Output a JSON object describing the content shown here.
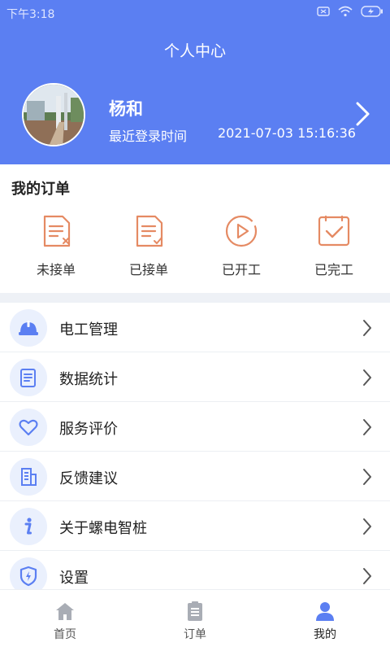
{
  "status_bar": {
    "time": "下午3:18"
  },
  "header": {
    "title": "个人中心",
    "username": "杨和",
    "last_login_label": "最近登录时间",
    "last_login_time": "2021-07-03 15:16:36"
  },
  "orders": {
    "title": "我的订单",
    "items": [
      {
        "label": "未接单",
        "icon": "order-pending-icon"
      },
      {
        "label": "已接单",
        "icon": "order-accepted-icon"
      },
      {
        "label": "已开工",
        "icon": "play-circle-icon"
      },
      {
        "label": "已完工",
        "icon": "check-square-icon"
      }
    ]
  },
  "menu": {
    "items": [
      {
        "label": "电工管理",
        "icon": "helmet-icon"
      },
      {
        "label": "数据统计",
        "icon": "document-icon"
      },
      {
        "label": "服务评价",
        "icon": "heart-icon"
      },
      {
        "label": "反馈建议",
        "icon": "building-icon"
      },
      {
        "label": "关于螺电智桩",
        "icon": "info-icon"
      },
      {
        "label": "设置",
        "icon": "shield-bolt-icon"
      }
    ]
  },
  "bottom_nav": {
    "tabs": [
      {
        "label": "首页",
        "icon": "home-icon"
      },
      {
        "label": "订单",
        "icon": "clipboard-icon"
      },
      {
        "label": "我的",
        "icon": "user-icon"
      }
    ],
    "active": "我的"
  },
  "colors": {
    "primary": "#5b7ff2",
    "order_icon": "#e58a63",
    "menu_icon_bg": "#eaf0fd",
    "menu_icon": "#5b7ff2"
  }
}
